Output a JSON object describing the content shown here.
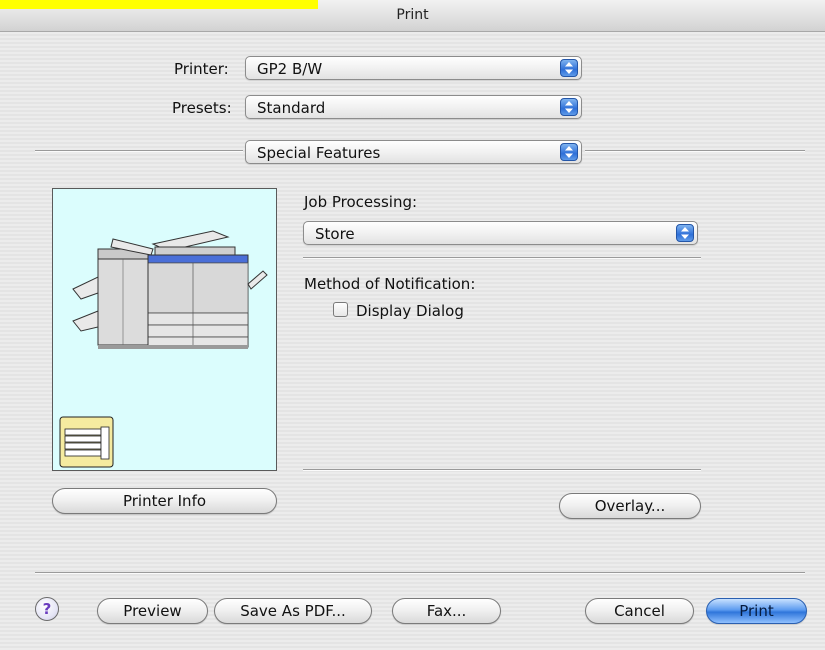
{
  "window": {
    "title": "Print"
  },
  "printer": {
    "label": "Printer:",
    "value": "GP2 B/W"
  },
  "presets": {
    "label": "Presets:",
    "value": "Standard"
  },
  "panel": {
    "value": "Special Features"
  },
  "job_processing": {
    "label": "Job Processing:",
    "value": "Store"
  },
  "notification": {
    "label": "Method of Notification:",
    "checkbox_label": "Display Dialog",
    "checked": false
  },
  "buttons": {
    "printer_info": "Printer Info",
    "overlay": "Overlay...",
    "help": "?",
    "preview": "Preview",
    "save_as_pdf": "Save As PDF...",
    "fax": "Fax...",
    "cancel": "Cancel",
    "print": "Print"
  },
  "icons": {
    "popup_arrows": "updown-arrows-icon",
    "printer_image": "copier-printer-illustration",
    "stack": "paper-stack-icon",
    "help": "help-icon"
  },
  "colors": {
    "preview_background": "#dbfdfd",
    "default_button": "#2f76db",
    "highlight": "#ffff00"
  }
}
